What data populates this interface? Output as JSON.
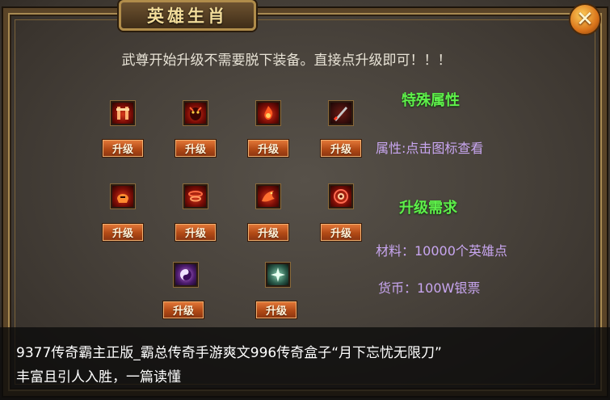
{
  "window": {
    "title": "英雄生肖",
    "close_symbol": "✕"
  },
  "notice": "武尊开始升级不需要脱下装备。直接点升级即可！！！",
  "upgrade_label": "升级",
  "icons": [
    {
      "name": "pillar-rune-icon"
    },
    {
      "name": "demon-mask-icon"
    },
    {
      "name": "flame-warrior-icon"
    },
    {
      "name": "dark-blade-icon"
    },
    {
      "name": "fire-helm-icon"
    },
    {
      "name": "red-vortex-icon"
    },
    {
      "name": "fire-dragon-icon"
    },
    {
      "name": "crimson-eye-icon"
    },
    {
      "name": "purple-taiji-icon"
    },
    {
      "name": "teal-star-icon"
    }
  ],
  "side": {
    "special_title": "特殊属性",
    "attr_hint": "属性:点击图标查看",
    "require_title": "升级需求",
    "material": "材料：10000个英雄点",
    "currency": "货币：100W银票"
  },
  "caption": {
    "line1": "9377传奇霸主正版_霸总传奇手游爽文996传奇盒子“月下忘忧无限刀”",
    "line2": "丰富且引人入胜，一篇读懂"
  },
  "colors": {
    "accent_green": "#5ef04a",
    "violet_text": "#c8a6f0",
    "button_orange": "#b24a16"
  }
}
